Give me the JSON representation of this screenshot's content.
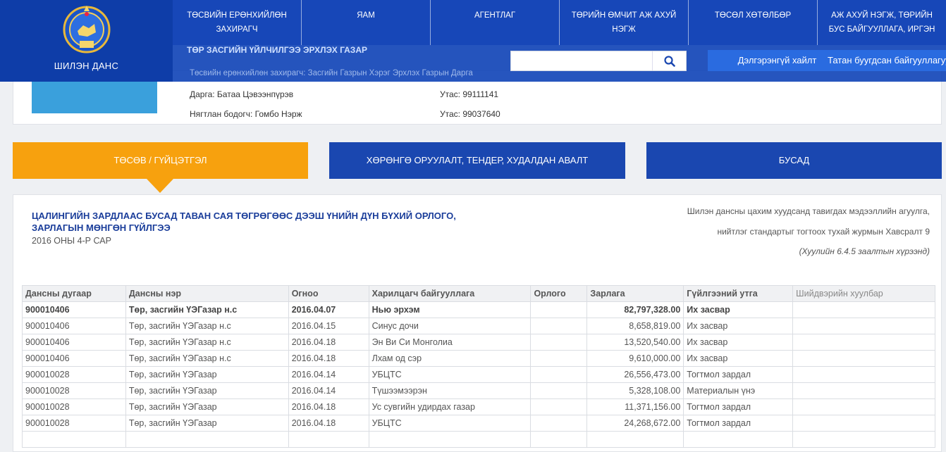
{
  "logo": {
    "label": "ШИЛЭН ДАНС"
  },
  "topnav": [
    "ТӨСВИЙН ЕРӨНХИЙЛӨН ЗАХИРАГЧ",
    "ЯАМ",
    "АГЕНТЛАГ",
    "ТӨРИЙН ӨМЧИТ АЖ АХУЙ НЭГЖ",
    "ТӨСӨЛ ХӨТӨЛБӨР",
    "АЖ АХУЙ НЭГЖ, ТӨРИЙН БУС БАЙГУУЛЛАГА, ИРГЭН"
  ],
  "subbar": {
    "ghost_title": "ТӨР ЗАСГИЙН ҮЙЛЧИЛГЭЭ ЭРХЛЭХ ГАЗАР",
    "ghost_sub": "Төсвийн ерөнхийлөн захирагч: Засгийн Газрын Хэрэг Эрхлэх Газрын Дарга",
    "search_value": "",
    "advanced_search": "Дэлгэрэнгүй хайлт",
    "dissolved_orgs": "Татан буугдсан байгууллагууд"
  },
  "info": {
    "director": "Дарга: Батаа Цэвээнпүрэв",
    "director_phone": "Утас: 99111141",
    "accountant": "Нягтлан бодогч: Гомбо Нэрж",
    "accountant_phone": "Утас: 99037640"
  },
  "tabs": [
    "ТӨСӨВ / ГҮЙЦЭТГЭЛ",
    "ХӨРӨНГӨ ОРУУЛАЛТ, ТЕНДЕР, ХУДАЛДАН АВАЛТ",
    "БУСАД"
  ],
  "report": {
    "title": "ЦАЛИНГИЙН ЗАРДЛААС БУСАД ТАВАН САЯ ТӨГРӨГӨӨС ДЭЭШ ҮНИЙН ДҮН БҮХИЙ ОРЛОГО, ЗАРЛАГЫН МӨНГӨН ГҮЙЛГЭЭ",
    "period": "2016 ОНЫ 4-Р САР",
    "ref_line1": "Шилэн дансны цахим хуудсанд тавигдах мэдээллийн агуулга,",
    "ref_line2": "нийтлэг стандартыг тогтоох тухай журмын Хавсралт 9",
    "ref_line3": "(Хуулийн 6.4.5 заалтын хүрээнд)"
  },
  "table": {
    "headers": [
      "Дансны дугаар",
      "Дансны нэр",
      "Огноо",
      "Харилцагч байгууллага",
      "Орлого",
      "Зарлага",
      "Гүйлгээний утга",
      "Шийдвэрийн хуулбар"
    ],
    "rows": [
      [
        "900010406",
        "Төр, засгийн ҮЭГазар н.с",
        "2016.04.07",
        "Нью эрхэм",
        "",
        "82,797,328.00",
        "Их засвар",
        ""
      ],
      [
        "900010406",
        "Төр, засгийн ҮЭГазар н.с",
        "2016.04.15",
        "Синус дочи",
        "",
        "8,658,819.00",
        "Их засвар",
        ""
      ],
      [
        "900010406",
        "Төр, засгийн ҮЭГазар н.с",
        "2016.04.18",
        "Эн Ви Си Монголиа",
        "",
        "13,520,540.00",
        "Их засвар",
        ""
      ],
      [
        "900010406",
        "Төр, засгийн ҮЭГазар н.с",
        "2016.04.18",
        "Лхам од сэр",
        "",
        "9,610,000.00",
        "Их засвар",
        ""
      ],
      [
        "900010028",
        "Төр, засгийн ҮЭГазар",
        "2016.04.14",
        "УБЦТС",
        "",
        "26,556,473.00",
        "Тогтмол зардал",
        ""
      ],
      [
        "900010028",
        "Төр, засгийн ҮЭГазар",
        "2016.04.14",
        "Түшээмээрэн",
        "",
        "5,328,108.00",
        "Материалын үнэ",
        ""
      ],
      [
        "900010028",
        "Төр, засгийн ҮЭГазар",
        "2016.04.18",
        "Ус сувгийн удирдах газар",
        "",
        "11,371,156.00",
        "Тогтмол зардал",
        ""
      ],
      [
        "900010028",
        "Төр, засгийн ҮЭГазар",
        "2016.04.18",
        "УБЦТС",
        "",
        "24,268,672.00",
        "Тогтмол зардал",
        ""
      ]
    ]
  },
  "colors": {
    "brand_blue": "#1747b8",
    "accent_orange": "#f7a10e",
    "title_blue": "#1a3d9a"
  }
}
